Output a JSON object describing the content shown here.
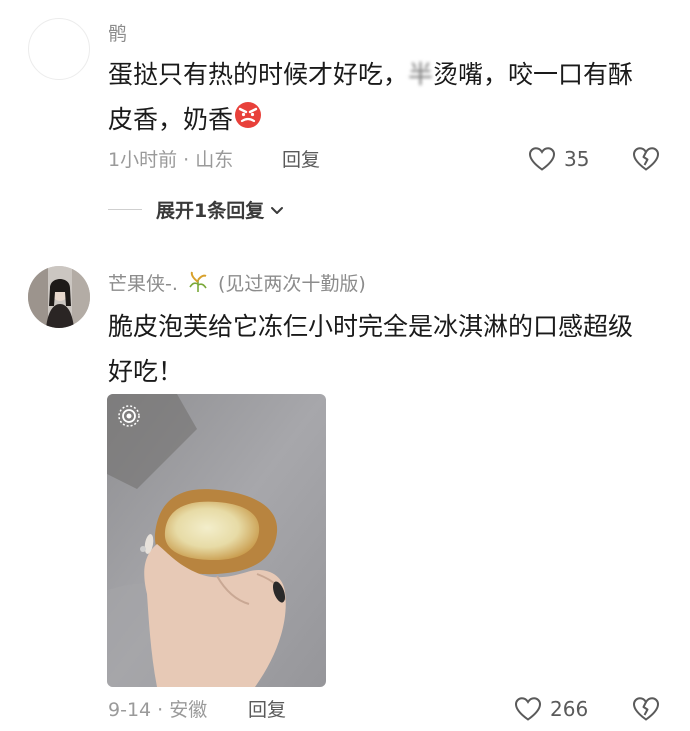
{
  "comments": [
    {
      "username": "鹘",
      "text_line1": "蛋挞只有热的时候才好吃，",
      "text_blurred": "半",
      "text_line1b": "烫嘴，咬一口有酥",
      "text_line2": "皮香，奶香",
      "emoji": "angry-face-emoji",
      "time_location": "1小时前 · 山东",
      "reply_label": "回复",
      "likes": "35",
      "expand_label": "展开1条回复"
    },
    {
      "username": "芒果侠-.",
      "username_suffix": "(见过两次十勤版)",
      "text_line1": "脆皮泡芙给它冻仨小时完全是冰淇淋的口感超级",
      "text_line2": "好吃！",
      "time_location": "9-14 · 安徽",
      "reply_label": "回复",
      "likes": "266"
    }
  ],
  "colors": {
    "meta": "#9a9a9a",
    "username": "#8c8c8c",
    "text": "#1a1a1a",
    "emoji_red": "#e8403a"
  }
}
